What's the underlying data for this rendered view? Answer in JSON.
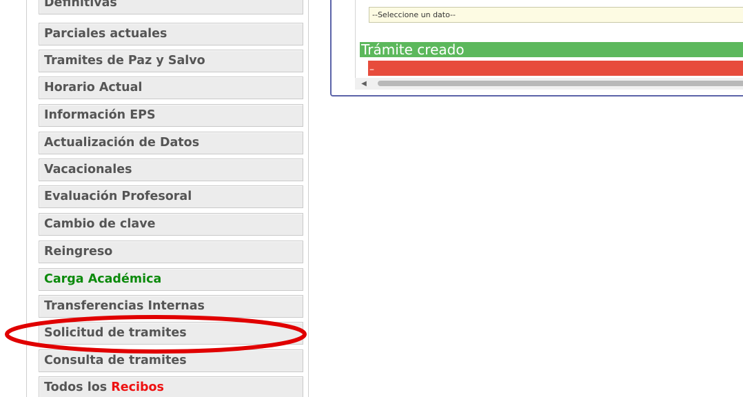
{
  "sidebar": {
    "items": [
      {
        "label": "Definitivas"
      },
      {
        "label": "Parciales actuales"
      },
      {
        "label": "Tramites de Paz y Salvo"
      },
      {
        "label": "Horario Actual"
      },
      {
        "label": "Información EPS"
      },
      {
        "label": "Actualización de Datos"
      },
      {
        "label": "Vacacionales"
      },
      {
        "label": "Evaluación Profesoral"
      },
      {
        "label": "Cambio de clave"
      },
      {
        "label": "Reingreso"
      },
      {
        "label": "Carga Académica"
      },
      {
        "label": "Transferencias Internas"
      },
      {
        "label": "Solicitud de tramites"
      },
      {
        "label": "Consulta de tramites"
      },
      {
        "label_prefix": "Todos los ",
        "label_highlight": "Recibos"
      }
    ],
    "active_item": "Carga Académica",
    "circled_item": "Solicitud de tramites",
    "active_color": "#0c8a0c",
    "highlight_color": "#ee1111"
  },
  "main": {
    "select": {
      "placeholder": "--Seleccione un dato--"
    },
    "status": {
      "message": "Trámite creado",
      "color": "#5cb85c"
    },
    "error": {
      "message": "–",
      "color": "#e74c3c"
    },
    "scrollbar": {
      "left_arrow": "◀"
    }
  },
  "annotation": {
    "color": "#e00000"
  }
}
